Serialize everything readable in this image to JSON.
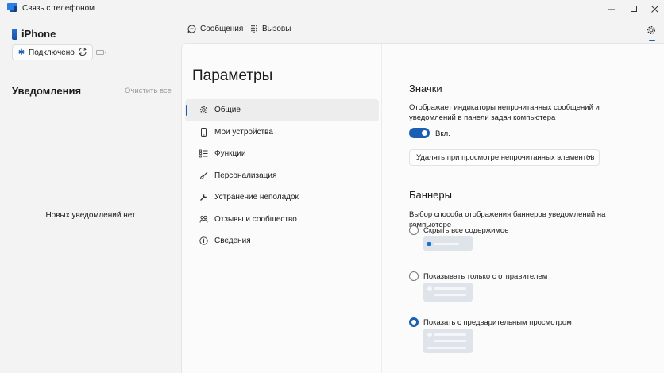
{
  "window": {
    "title": "Связь с телефоном"
  },
  "device": {
    "name": "iPhone",
    "status_label": "Подключено"
  },
  "notifications": {
    "heading": "Уведомления",
    "clear_all": "Очистить все",
    "empty_text": "Новых уведомлений нет"
  },
  "topnav": {
    "messages_label": "Сообщения",
    "calls_label": "Вызовы"
  },
  "settings": {
    "title": "Параметры",
    "nav_items": [
      {
        "label": "Общие",
        "icon": "gear-icon"
      },
      {
        "label": "Мои устройства",
        "icon": "phone-icon"
      },
      {
        "label": "Функции",
        "icon": "list-icon"
      },
      {
        "label": "Персонализация",
        "icon": "brush-icon"
      },
      {
        "label": "Устранение неполадок",
        "icon": "wrench-icon"
      },
      {
        "label": "Отзывы и сообщество",
        "icon": "people-icon"
      },
      {
        "label": "Сведения",
        "icon": "info-icon"
      }
    ]
  },
  "badges": {
    "title": "Значки",
    "description": "Отображает индикаторы непрочитанных сообщений и уведомлений в панели задач компьютера",
    "toggle_label": "Вкл.",
    "toggle_on": true,
    "dropdown_value": "Удалять при просмотре непрочитанных элементов"
  },
  "banners": {
    "title": "Баннеры",
    "description": "Выбор способа отображения баннеров уведомлений на компьютере",
    "options": [
      {
        "label": "Скрыть все содержимое",
        "checked": false
      },
      {
        "label": "Показывать только с отправителем",
        "checked": false
      },
      {
        "label": "Показать с предварительным просмотром",
        "checked": true
      }
    ]
  },
  "colors": {
    "accent": "#1a5fb4",
    "background": "#f3f3f3",
    "panel": "#fbfbfb"
  }
}
